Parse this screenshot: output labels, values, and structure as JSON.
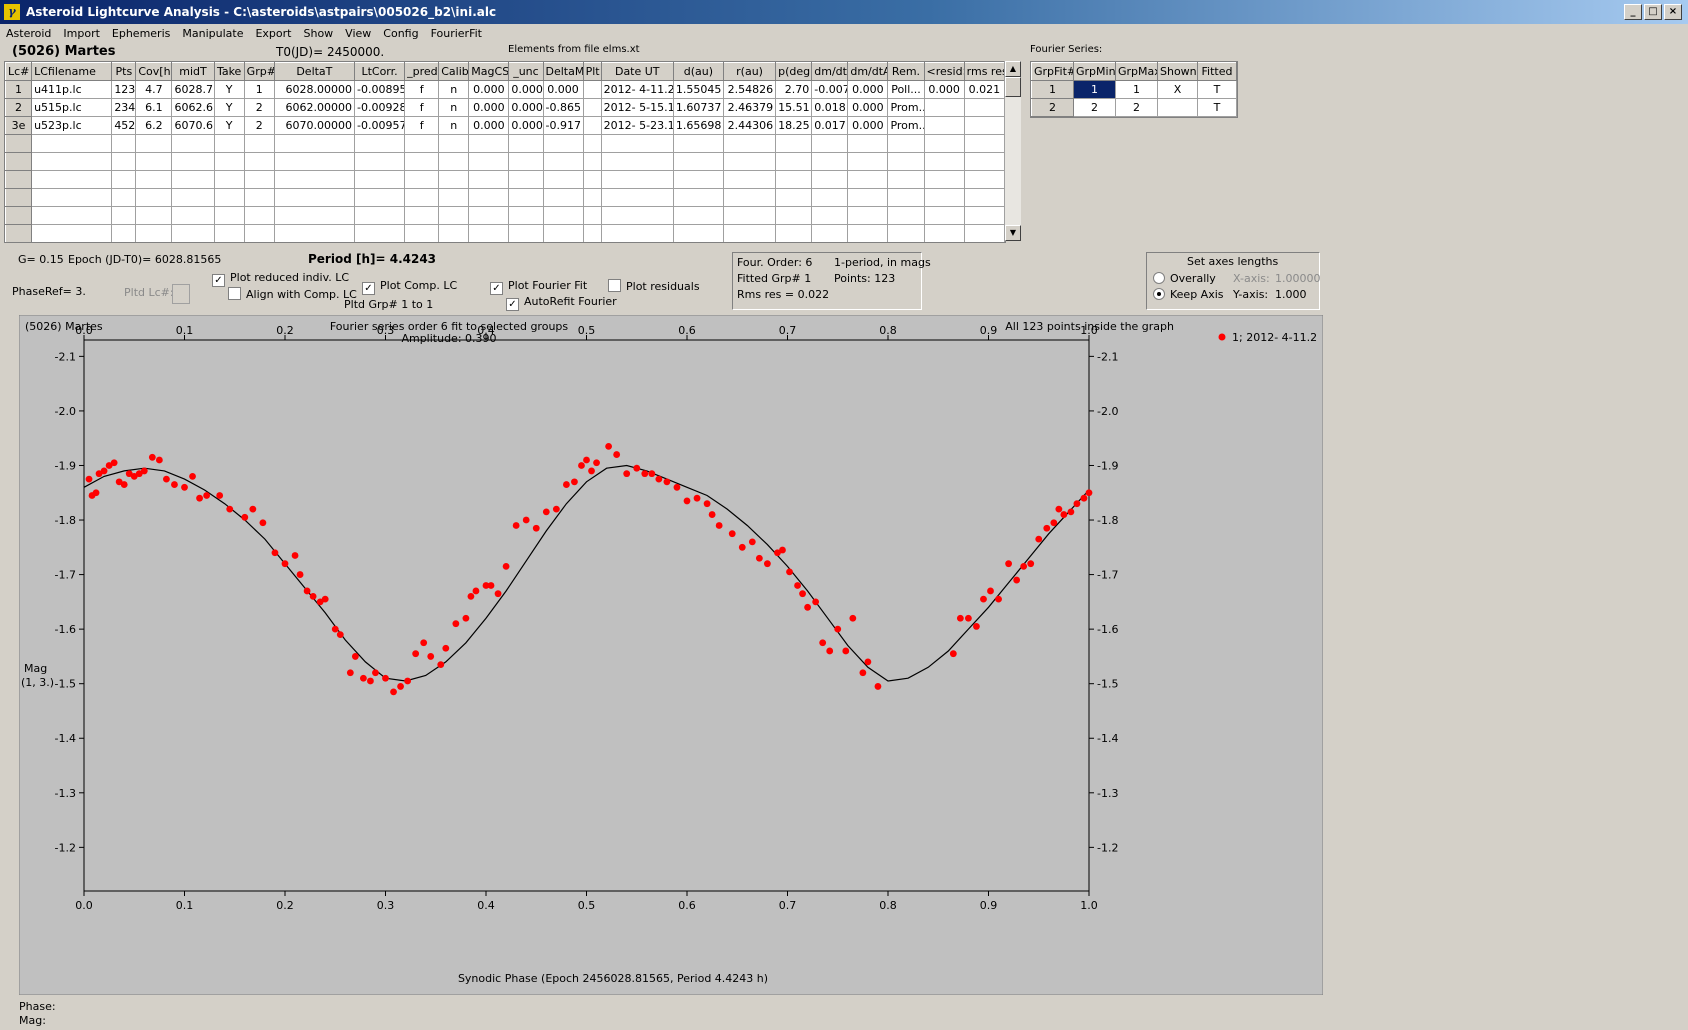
{
  "window": {
    "title": "Asteroid Lightcurve Analysis - C:\\asteroids\\astpairs\\005026_b2\\ini.alc",
    "min": "_",
    "max": "□",
    "close": "×",
    "app_icon": "γ"
  },
  "menu": [
    "Asteroid",
    "Import",
    "Ephemeris",
    "Manipulate",
    "Export",
    "Show",
    "View",
    "Config",
    "FourierFit"
  ],
  "info": {
    "asteroid_name": "(5026) Martes",
    "t0": "T0(JD)= 2450000.",
    "elements": "Elements from file elms.xt"
  },
  "lc_table": {
    "headers": [
      "Lc#",
      "LCfilename",
      "Pts",
      "Cov[h]",
      "midT",
      "Take",
      "Grp#",
      "DeltaT",
      "LtCorr.",
      "_pred.",
      "Calib.",
      "MagCS",
      "_unc",
      "DeltaM",
      "Plt",
      "Date UT",
      "d(au)",
      "r(au)",
      "p(deg)",
      "dm/dt",
      "dm/dtA",
      "Rem.",
      "<resid>",
      "rms res"
    ],
    "rows": [
      [
        "1",
        "u411p.lc",
        "123",
        "4.7",
        "6028.7",
        "Y",
        "1",
        "6028.00000",
        "-0.00895",
        "f",
        "n",
        "0.000",
        "0.000",
        "0.000",
        "",
        "2012- 4-11.2",
        "1.55045",
        "2.54826",
        "2.70",
        "-0.007",
        "0.000",
        "Poll...",
        "0.000",
        "0.021"
      ],
      [
        "2",
        "u515p.lc",
        "234",
        "6.1",
        "6062.6",
        "Y",
        "2",
        "6062.00000",
        "-0.00928",
        "f",
        "n",
        "0.000",
        "0.000",
        "-0.865",
        "",
        "2012- 5-15.1",
        "1.60737",
        "2.46379",
        "15.51",
        "0.018",
        "0.000",
        "Prom...",
        "",
        ""
      ],
      [
        "3e",
        "u523p.lc",
        "452",
        "6.2",
        "6070.6",
        "Y",
        "2",
        "6070.00000",
        "-0.00957",
        "f",
        "n",
        "0.000",
        "0.000",
        "-0.917",
        "",
        "2012- 5-23.1",
        "1.65698",
        "2.44306",
        "18.25",
        "0.017",
        "0.000",
        "Prom...",
        "",
        ""
      ]
    ],
    "empty_rows": 6,
    "scroll_up": "▲",
    "scroll_down": "▼"
  },
  "fourier_series": {
    "label": "Fourier Series:",
    "headers": [
      "GrpFit#",
      "GrpMin",
      "GrpMax",
      "Shown",
      "Fitted"
    ],
    "rows": [
      [
        "1",
        "1",
        "1",
        "X",
        "T"
      ],
      [
        "2",
        "2",
        "2",
        "",
        "T"
      ]
    ]
  },
  "controls": {
    "g": "G= 0.15",
    "epoch": "Epoch (JD-T0)= 6028.81565",
    "period": "Period [h]= 4.4243",
    "phase_ref": "PhaseRef= 3.",
    "pltd_lc": "Pltd Lc#:",
    "plot_reduced": "Plot reduced indiv. LC",
    "align_comp": "Align with Comp. LC",
    "plot_comp": "Plot Comp. LC",
    "pltd_grp": "Pltd Grp#  1   to   1",
    "plot_fourier": "Plot Fourier Fit",
    "autorefit": "AutoRefit Fourier",
    "plot_residuals": "Plot residuals",
    "check": "✓"
  },
  "fit_info": {
    "order": "Four. Order:  6",
    "mode": "1-period, in mags",
    "fitted_grp": "Fitted Grp# 1",
    "points": "Points: 123",
    "rms": "Rms res      = 0.022"
  },
  "axes_box": {
    "title": "Set axes lengths",
    "overall": "Overally",
    "keep": "Keep Axis",
    "x_axis_label": "X-axis:",
    "x_axis_val": "1.00000",
    "y_axis_label": "Y-axis:",
    "y_axis_val": "1.000"
  },
  "status": {
    "phase": "Phase:",
    "mag": "Mag:"
  },
  "chart_data": {
    "type": "scatter",
    "title_left": "(5026) Martes",
    "title_center": "Fourier series order 6 fit to selected groups",
    "amplitude": "Amplitude: 0.390",
    "note_right": "All 123 points inside the graph",
    "legend": "1; 2012- 4-11.2",
    "xlabel": "Synodic Phase (Epoch 2456028.81565, Period 4.4243 h)",
    "ylabel_1": "Mag",
    "ylabel_2": "(1, 3.)",
    "xlim": [
      0.0,
      1.0
    ],
    "ylim": [
      -1.12,
      -2.13
    ],
    "x_ticks": [
      "0.0",
      "0.1",
      "0.2",
      "0.3",
      "0.4",
      "0.5",
      "0.6",
      "0.7",
      "0.8",
      "0.9",
      "1.0"
    ],
    "y_ticks": [
      "-2.1",
      "-2.0",
      "-1.9",
      "-1.8",
      "-1.7",
      "-1.6",
      "-1.5",
      "-1.4",
      "-1.3",
      "-1.2"
    ],
    "point_color": "#ff0000",
    "fit_curve": [
      [
        0.0,
        -1.86
      ],
      [
        0.02,
        -1.88
      ],
      [
        0.04,
        -1.89
      ],
      [
        0.06,
        -1.895
      ],
      [
        0.08,
        -1.89
      ],
      [
        0.1,
        -1.875
      ],
      [
        0.12,
        -1.855
      ],
      [
        0.14,
        -1.83
      ],
      [
        0.16,
        -1.8
      ],
      [
        0.18,
        -1.765
      ],
      [
        0.2,
        -1.72
      ],
      [
        0.22,
        -1.675
      ],
      [
        0.24,
        -1.63
      ],
      [
        0.26,
        -1.58
      ],
      [
        0.28,
        -1.54
      ],
      [
        0.3,
        -1.51
      ],
      [
        0.32,
        -1.505
      ],
      [
        0.34,
        -1.515
      ],
      [
        0.36,
        -1.54
      ],
      [
        0.38,
        -1.575
      ],
      [
        0.4,
        -1.62
      ],
      [
        0.42,
        -1.67
      ],
      [
        0.44,
        -1.725
      ],
      [
        0.46,
        -1.78
      ],
      [
        0.48,
        -1.83
      ],
      [
        0.5,
        -1.87
      ],
      [
        0.52,
        -1.895
      ],
      [
        0.54,
        -1.9
      ],
      [
        0.56,
        -1.89
      ],
      [
        0.58,
        -1.875
      ],
      [
        0.6,
        -1.86
      ],
      [
        0.62,
        -1.845
      ],
      [
        0.64,
        -1.82
      ],
      [
        0.66,
        -1.79
      ],
      [
        0.68,
        -1.755
      ],
      [
        0.7,
        -1.715
      ],
      [
        0.72,
        -1.67
      ],
      [
        0.74,
        -1.62
      ],
      [
        0.76,
        -1.57
      ],
      [
        0.78,
        -1.53
      ],
      [
        0.8,
        -1.505
      ],
      [
        0.82,
        -1.51
      ],
      [
        0.84,
        -1.53
      ],
      [
        0.86,
        -1.56
      ],
      [
        0.88,
        -1.6
      ],
      [
        0.9,
        -1.64
      ],
      [
        0.92,
        -1.685
      ],
      [
        0.94,
        -1.73
      ],
      [
        0.96,
        -1.775
      ],
      [
        0.98,
        -1.815
      ],
      [
        1.0,
        -1.855
      ]
    ],
    "points": [
      [
        0.005,
        -1.875
      ],
      [
        0.008,
        -1.845
      ],
      [
        0.012,
        -1.85
      ],
      [
        0.015,
        -1.885
      ],
      [
        0.02,
        -1.89
      ],
      [
        0.025,
        -1.9
      ],
      [
        0.03,
        -1.905
      ],
      [
        0.035,
        -1.87
      ],
      [
        0.04,
        -1.865
      ],
      [
        0.045,
        -1.885
      ],
      [
        0.05,
        -1.88
      ],
      [
        0.055,
        -1.885
      ],
      [
        0.06,
        -1.89
      ],
      [
        0.068,
        -1.915
      ],
      [
        0.075,
        -1.91
      ],
      [
        0.082,
        -1.875
      ],
      [
        0.09,
        -1.865
      ],
      [
        0.1,
        -1.86
      ],
      [
        0.108,
        -1.88
      ],
      [
        0.115,
        -1.84
      ],
      [
        0.122,
        -1.845
      ],
      [
        0.135,
        -1.845
      ],
      [
        0.145,
        -1.82
      ],
      [
        0.16,
        -1.805
      ],
      [
        0.168,
        -1.82
      ],
      [
        0.178,
        -1.795
      ],
      [
        0.19,
        -1.74
      ],
      [
        0.2,
        -1.72
      ],
      [
        0.21,
        -1.735
      ],
      [
        0.215,
        -1.7
      ],
      [
        0.222,
        -1.67
      ],
      [
        0.228,
        -1.66
      ],
      [
        0.235,
        -1.65
      ],
      [
        0.24,
        -1.655
      ],
      [
        0.25,
        -1.6
      ],
      [
        0.255,
        -1.59
      ],
      [
        0.265,
        -1.52
      ],
      [
        0.27,
        -1.55
      ],
      [
        0.278,
        -1.51
      ],
      [
        0.285,
        -1.505
      ],
      [
        0.29,
        -1.52
      ],
      [
        0.3,
        -1.51
      ],
      [
        0.308,
        -1.485
      ],
      [
        0.315,
        -1.495
      ],
      [
        0.322,
        -1.505
      ],
      [
        0.33,
        -1.555
      ],
      [
        0.338,
        -1.575
      ],
      [
        0.345,
        -1.55
      ],
      [
        0.355,
        -1.535
      ],
      [
        0.36,
        -1.565
      ],
      [
        0.37,
        -1.61
      ],
      [
        0.38,
        -1.62
      ],
      [
        0.385,
        -1.66
      ],
      [
        0.39,
        -1.67
      ],
      [
        0.4,
        -1.68
      ],
      [
        0.405,
        -1.68
      ],
      [
        0.412,
        -1.665
      ],
      [
        0.42,
        -1.715
      ],
      [
        0.43,
        -1.79
      ],
      [
        0.44,
        -1.8
      ],
      [
        0.45,
        -1.785
      ],
      [
        0.46,
        -1.815
      ],
      [
        0.47,
        -1.82
      ],
      [
        0.48,
        -1.865
      ],
      [
        0.488,
        -1.87
      ],
      [
        0.495,
        -1.9
      ],
      [
        0.5,
        -1.91
      ],
      [
        0.505,
        -1.89
      ],
      [
        0.51,
        -1.905
      ],
      [
        0.522,
        -1.935
      ],
      [
        0.53,
        -1.92
      ],
      [
        0.54,
        -1.885
      ],
      [
        0.55,
        -1.895
      ],
      [
        0.558,
        -1.885
      ],
      [
        0.565,
        -1.885
      ],
      [
        0.572,
        -1.875
      ],
      [
        0.58,
        -1.87
      ],
      [
        0.59,
        -1.86
      ],
      [
        0.6,
        -1.835
      ],
      [
        0.61,
        -1.84
      ],
      [
        0.62,
        -1.83
      ],
      [
        0.625,
        -1.81
      ],
      [
        0.632,
        -1.79
      ],
      [
        0.645,
        -1.775
      ],
      [
        0.655,
        -1.75
      ],
      [
        0.665,
        -1.76
      ],
      [
        0.672,
        -1.73
      ],
      [
        0.68,
        -1.72
      ],
      [
        0.69,
        -1.74
      ],
      [
        0.695,
        -1.745
      ],
      [
        0.702,
        -1.705
      ],
      [
        0.71,
        -1.68
      ],
      [
        0.715,
        -1.665
      ],
      [
        0.72,
        -1.64
      ],
      [
        0.728,
        -1.65
      ],
      [
        0.735,
        -1.575
      ],
      [
        0.742,
        -1.56
      ],
      [
        0.75,
        -1.6
      ],
      [
        0.758,
        -1.56
      ],
      [
        0.765,
        -1.62
      ],
      [
        0.775,
        -1.52
      ],
      [
        0.78,
        -1.54
      ],
      [
        0.79,
        -1.495
      ],
      [
        0.865,
        -1.555
      ],
      [
        0.872,
        -1.62
      ],
      [
        0.88,
        -1.62
      ],
      [
        0.888,
        -1.605
      ],
      [
        0.895,
        -1.655
      ],
      [
        0.902,
        -1.67
      ],
      [
        0.91,
        -1.655
      ],
      [
        0.92,
        -1.72
      ],
      [
        0.928,
        -1.69
      ],
      [
        0.935,
        -1.715
      ],
      [
        0.942,
        -1.72
      ],
      [
        0.95,
        -1.765
      ],
      [
        0.958,
        -1.785
      ],
      [
        0.965,
        -1.795
      ],
      [
        0.97,
        -1.82
      ],
      [
        0.975,
        -1.81
      ],
      [
        0.982,
        -1.815
      ],
      [
        0.988,
        -1.83
      ],
      [
        0.995,
        -1.84
      ],
      [
        1.0,
        -1.85
      ]
    ]
  }
}
